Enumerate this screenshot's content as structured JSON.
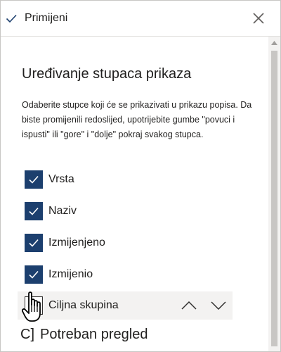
{
  "toolbar": {
    "apply_label": "Primijeni",
    "apply_icon": "check-icon",
    "close_icon": "close-icon"
  },
  "panel": {
    "title": "Uređivanje stupaca prikaza",
    "description": "Odaberite stupce koji će se prikazivati u prikazu popisa. Da biste promijenili redoslijed, upotrijebite gumbe \"povuci i ispusti\" ili \"gore\" i \"dolje\" pokraj svakog stupca."
  },
  "columns": [
    {
      "label": "Vrsta",
      "checked": true
    },
    {
      "label": "Naziv",
      "checked": true
    },
    {
      "label": "Izmijenjeno",
      "checked": true
    },
    {
      "label": "Izmijenio",
      "checked": true
    },
    {
      "label": "Ciljna skupina",
      "checked": false
    }
  ],
  "partial_item": {
    "box_text": "C]",
    "label": "Potreban pregled"
  },
  "colors": {
    "checkbox_checked": "#1c3f6e",
    "hover_row": "#f3f2f1",
    "text": "#201f1e"
  }
}
